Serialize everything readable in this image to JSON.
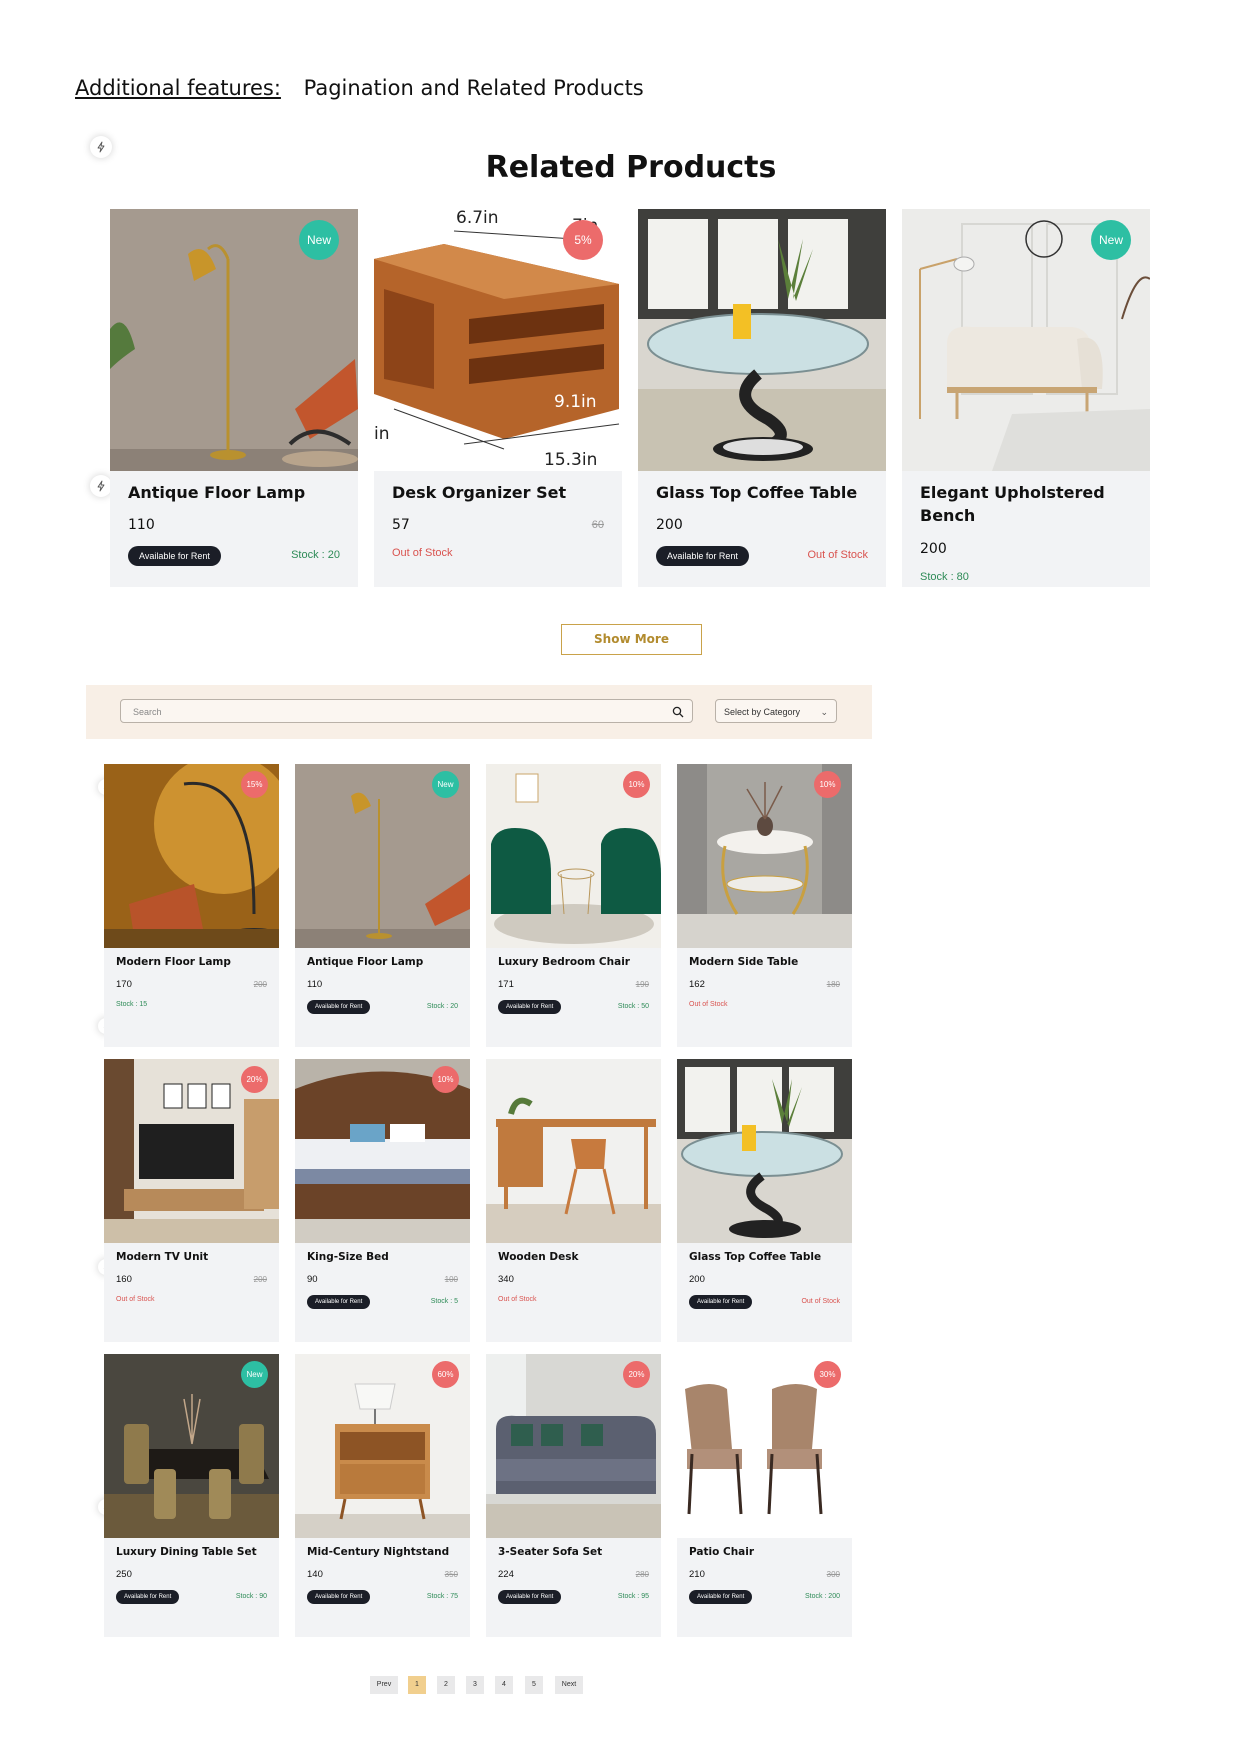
{
  "doc": {
    "heading": "Additional features:",
    "subheading": "Pagination and Related Products"
  },
  "related": {
    "title": "Related Products",
    "show_more": "Show More",
    "items": [
      {
        "name": "Antique Floor Lamp",
        "price": "110",
        "old_price": "",
        "rent": "Available for Rent",
        "stock": "Stock : 20",
        "badge": "New"
      },
      {
        "name": "Desk Organizer Set",
        "price": "57",
        "old_price": "60",
        "rent": "",
        "stock": "Out of Stock",
        "badge": "5%"
      },
      {
        "name": "Glass Top Coffee Table",
        "price": "200",
        "old_price": "",
        "rent": "Available for Rent",
        "stock": "Out of Stock",
        "badge": ""
      },
      {
        "name": "Elegant Upholstered Bench",
        "price": "200",
        "old_price": "",
        "rent": "",
        "stock": "Stock : 80",
        "badge": "New"
      }
    ],
    "dims": {
      "w": "6.7in",
      "d": "7in",
      "h": "9.1in",
      "l": "15.3in",
      "in": "in"
    }
  },
  "filter": {
    "search_placeholder": "Search",
    "category": "Select by Category",
    "chevron": "⌄"
  },
  "grid": [
    {
      "name": "Modern Floor Lamp",
      "price": "170",
      "old_price": "200",
      "rent": "",
      "stock": "Stock : 15",
      "badge": "15%"
    },
    {
      "name": "Antique Floor Lamp",
      "price": "110",
      "old_price": "",
      "rent": "Available for Rent",
      "stock": "Stock : 20",
      "badge": "New"
    },
    {
      "name": "Luxury Bedroom Chair",
      "price": "171",
      "old_price": "190",
      "rent": "Available for Rent",
      "stock": "Stock : 50",
      "badge": "10%"
    },
    {
      "name": "Modern Side Table",
      "price": "162",
      "old_price": "180",
      "rent": "",
      "stock": "Out of Stock",
      "badge": "10%"
    },
    {
      "name": "Modern TV Unit",
      "price": "160",
      "old_price": "200",
      "rent": "",
      "stock": "Out of Stock",
      "badge": "20%"
    },
    {
      "name": "King-Size Bed",
      "price": "90",
      "old_price": "100",
      "rent": "Available for Rent",
      "stock": "Stock : 5",
      "badge": "10%"
    },
    {
      "name": "Wooden Desk",
      "price": "340",
      "old_price": "",
      "rent": "",
      "stock": "Out of Stock",
      "badge": ""
    },
    {
      "name": "Glass Top Coffee Table",
      "price": "200",
      "old_price": "",
      "rent": "Available for Rent",
      "stock": "Out of Stock",
      "badge": ""
    },
    {
      "name": "Luxury Dining Table Set",
      "price": "250",
      "old_price": "",
      "rent": "Available for Rent",
      "stock": "Stock : 90",
      "badge": "New"
    },
    {
      "name": "Mid-Century Nightstand",
      "price": "140",
      "old_price": "350",
      "rent": "Available for Rent",
      "stock": "Stock : 75",
      "badge": "60%"
    },
    {
      "name": "3-Seater Sofa Set",
      "price": "224",
      "old_price": "280",
      "rent": "Available for Rent",
      "stock": "Stock : 95",
      "badge": "20%"
    },
    {
      "name": "Patio Chair",
      "price": "210",
      "old_price": "300",
      "rent": "Available for Rent",
      "stock": "Stock : 200",
      "badge": "30%"
    }
  ],
  "pagination": {
    "prev": "Prev",
    "pages": [
      "1",
      "2",
      "3",
      "4",
      "5"
    ],
    "next": "Next",
    "current": "1"
  },
  "colors": {
    "new_badge": "#2dbfa3",
    "sale_badge": "#ec6b6b",
    "in_stock": "#2e8b57",
    "out_of_stock": "#d9534f",
    "pill": "#1b1e27",
    "accent": "#c9a24a"
  }
}
